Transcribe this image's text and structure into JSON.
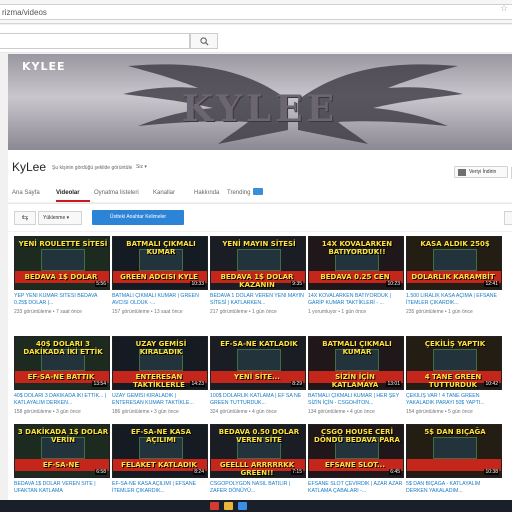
{
  "browser": {
    "url": "rizma/videos"
  },
  "search": {
    "placeholder": ""
  },
  "banner": {
    "title": "KYLEE",
    "logo": "KYLEE"
  },
  "channel": {
    "name": "KyLee",
    "subtitle": "Şu kişinin gördüğü şekilde görüntüle",
    "viewer_select": "Siz ▾",
    "verify_label": "Veriyi İndirin",
    "tabs": [
      "Ana Sayfa",
      "Videolar",
      "Oynatma listeleri",
      "Kanallar",
      "Hakkında",
      "Trending"
    ]
  },
  "filters": {
    "back": "⇆",
    "sort_label": "Yüklenme ▾",
    "active_button": "Üstteki Anahtar Kelimeler"
  },
  "videos": [
    {
      "thumb_top": "YENİ ROULETTE SİTESİ",
      "thumb_bottom": "BEDAVA 1$ DOLAR",
      "duration": "5:56",
      "title": "YEP YENİ KUMAR SİTESİ BEDAVA 0.25$ DOLAR |...",
      "meta": "233 görüntüleme • 7 saat önce"
    },
    {
      "thumb_top": "BATMALI ÇIKMALI KUMAR",
      "thumb_bottom": "GREEN ADCISI KYLE",
      "duration": "10:33",
      "title": "BATMALI ÇIKMALI KUMAR | GREEN AVCISI OLDUK -...",
      "meta": "157 görüntüleme • 13 saat önce"
    },
    {
      "thumb_top": "YENİ MAYIN SİTESİ",
      "thumb_bottom": "BEDAVA 1$ DOLAR KAZANIN",
      "duration": "9:35",
      "title": "BEDAVA 1 DOLAR VEREN YENİ MAYIN SİTESİ | KATLARKEN...",
      "meta": "217 görüntüleme • 1 gün önce"
    },
    {
      "thumb_top": "14X KOVALARKEN BATIYORDUK!!",
      "thumb_bottom": "BEDAVA 0.25 CEN",
      "duration": "10:23",
      "title": "14X KOVALARKEN BATIYORDUK | GARİP KUMAR TAKTİKLERİ - ...",
      "meta": "1 yorumluyor • 1 gün önce"
    },
    {
      "thumb_top": "KASA ALDIK 250$",
      "thumb_bottom": "DOLARLIK KARAMBİT",
      "duration": "12:41",
      "title": "1.500 LİRALIK KASA AÇIMA | EFSANE İTEMLER ÇIKARDIK...",
      "meta": "235 görüntüleme • 1 gün önce"
    },
    {
      "thumb_top": "40$ DOLARI 3 DAKİKADA İKİ ETTİK",
      "thumb_bottom": "EF-SA-NE BATTIK",
      "duration": "13:54",
      "title": "40$ DOLARI 3 DAKİKADA İKİ ETTİK... | KATLAYALIM DERKEN...",
      "meta": "158 görüntüleme • 3 gün önce"
    },
    {
      "thumb_top": "UZAY GEMİSİ KIRALADIK",
      "thumb_bottom": "ENTERESAN TAKTİKLERLE KATLAMAYI ÇALIŞTIK",
      "duration": "14:23",
      "title": "UZAY GEMİSİ KIRALADIK | ENTERESAN KUMAR TAKTİKLE...",
      "meta": "186 görüntüleme • 3 gün önce"
    },
    {
      "thumb_top": "EF-SA-NE KATLADIK",
      "thumb_bottom": "YENİ SİTE...",
      "duration": "8:29",
      "title": "100$ DOLARLIK KATLAMA | EF SA NE GREEN TUTTURDUK...",
      "meta": "324 görüntüleme • 4 gün önce"
    },
    {
      "thumb_top": "BATMALI ÇIKMALI KUMAR",
      "thumb_bottom": "SİZİN İÇİN KATLAMAYA ÇALIŞTIM",
      "duration": "13:01",
      "title": "BATMALI ÇIKMALI KUMAR | HER ŞEY SİZİN İÇİN - CSGOHİTON...",
      "meta": "134 görüntüleme • 4 gün önce"
    },
    {
      "thumb_top": "ÇEKİLİŞ YAPTIK",
      "thumb_bottom": "4 TANE GREEN TUTTURDUK",
      "duration": "10:42",
      "title": "ÇEKİLİŞ VAR ! 4 TANE GREEN YAKALADIK PARAYI 50$ YAPTI...",
      "meta": "154 görüntüleme • 5 gün önce"
    },
    {
      "thumb_top": "3 DAKİKADA 1$ DOLAR VERİN",
      "thumb_bottom": "EF-SA-NE",
      "duration": "6:58",
      "title": "BEDAVA 1$ DOLAR VEREN SİTE | UFAKTAN KATLAMA",
      "meta": ""
    },
    {
      "thumb_top": "EF-SA-NE KASA AÇILIMI",
      "thumb_bottom": "FELAKET KATLADIK",
      "duration": "8:24",
      "title": "EF-SA-NE KASA AÇILIMI | EFSANE İTEMLER ÇIKARDIK...",
      "meta": ""
    },
    {
      "thumb_top": "BEDAVA 0.50 DOLAR VEREN SİTE",
      "thumb_bottom": "GEELLL ARRRRRKK GREEN!!",
      "duration": "7:15",
      "title": "CSGOPOLYGON NASIL BATİLİR | ZAFER DÖNÜYÜ...",
      "meta": ""
    },
    {
      "thumb_top": "CSGO HOUSE CERİ DÖNDÜ BEDAVA PARA",
      "thumb_bottom": "EFSANE SLOT...",
      "duration": "6:45",
      "title": "EFSANE SLOT ÇEVİRDİK | AZAR AZAR KATLAMA ÇABALARI -...",
      "meta": ""
    },
    {
      "thumb_top": "5$ DAN BIÇAĞA",
      "thumb_bottom": "",
      "duration": "10:38",
      "title": "5$ DAN BIÇAĞA - KATLAYALIM DERKEN YAKALADIM...",
      "meta": ""
    }
  ],
  "colors": {
    "accent_red": "#cc181e",
    "link_blue": "#167ac6",
    "button_blue": "#2c84d6",
    "thumb_yellow": "#ffe23c"
  }
}
